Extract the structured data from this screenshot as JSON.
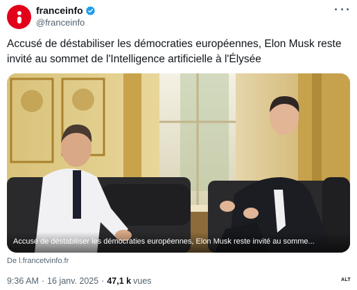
{
  "account": {
    "display_name": "franceinfo",
    "handle": "@franceinfo",
    "verified": true,
    "avatar_icon": "franceinfo-logo-icon",
    "avatar_color": "#e2001a"
  },
  "tweet": {
    "text": "Accusé de déstabiliser les démocraties européennes, Elon Musk reste invité au sommet de l'Intelligence artificielle à l'Élysée",
    "more_icon": "more-options-icon"
  },
  "media": {
    "caption": "Accusé de déstabiliser les démocraties européennes, Elon Musk reste invité au somme...",
    "source": "De l.francetvinfo.fr",
    "alt_badge": "ALT"
  },
  "meta": {
    "time": "9:36 AM",
    "separator": "·",
    "date": "16 janv. 2025",
    "views_count": "47,1 k",
    "views_label": "vues"
  },
  "colors": {
    "verified": "#1d9bf0",
    "text": "#0f1419",
    "secondary": "#536471"
  }
}
